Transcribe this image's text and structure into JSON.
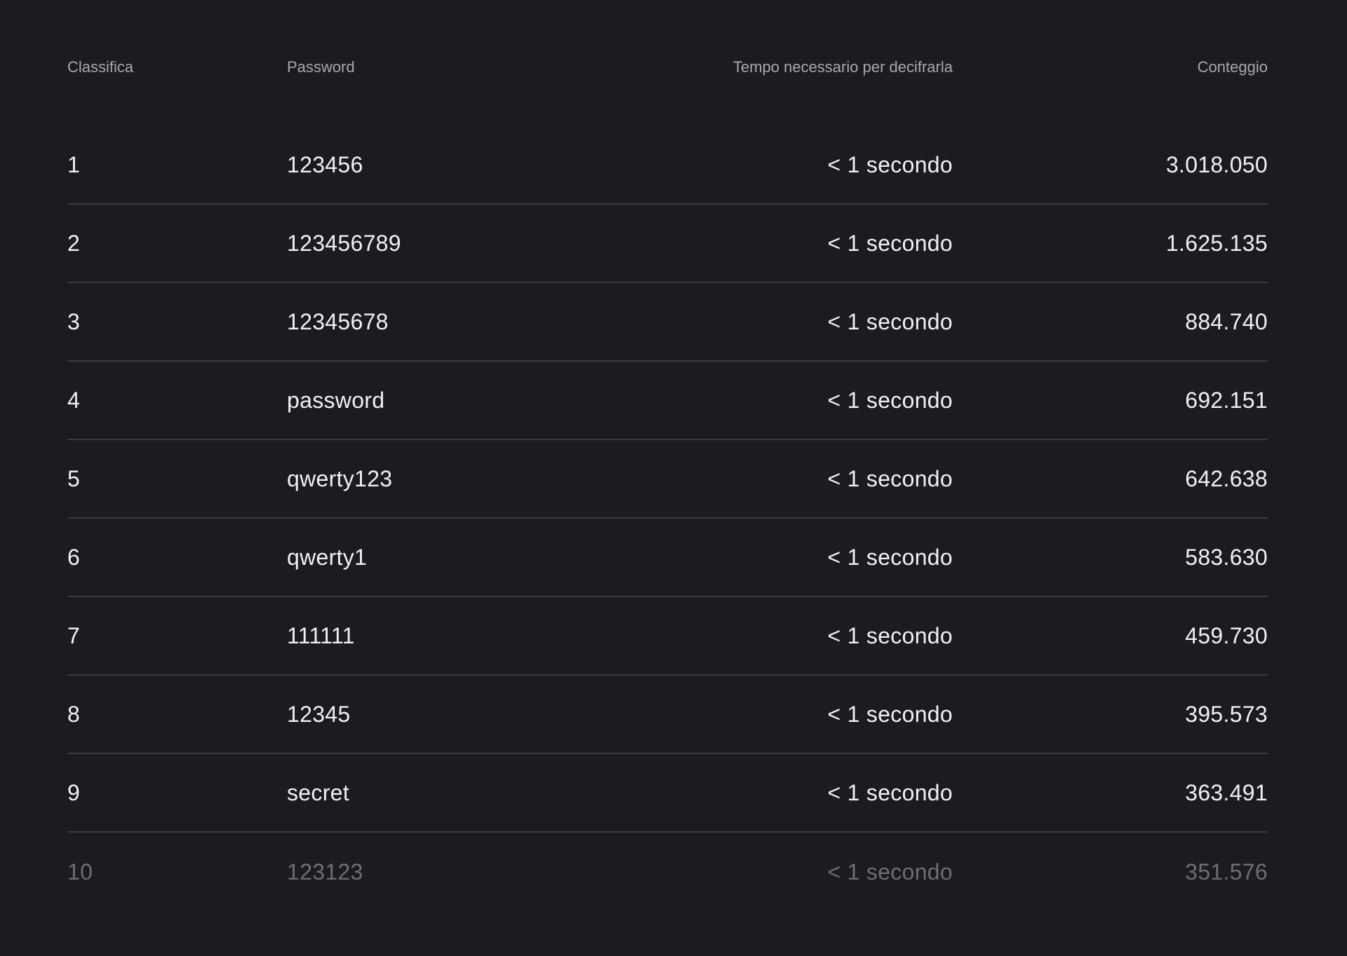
{
  "table": {
    "headers": {
      "rank": "Classifica",
      "password": "Password",
      "time": "Tempo necessario per decifrarla",
      "count": "Conteggio"
    },
    "rows": [
      {
        "rank": "1",
        "password": "123456",
        "time": "< 1 secondo",
        "count": "3.018.050"
      },
      {
        "rank": "2",
        "password": "123456789",
        "time": "< 1 secondo",
        "count": "1.625.135"
      },
      {
        "rank": "3",
        "password": "12345678",
        "time": "< 1 secondo",
        "count": "884.740"
      },
      {
        "rank": "4",
        "password": "password",
        "time": "< 1 secondo",
        "count": "692.151"
      },
      {
        "rank": "5",
        "password": "qwerty123",
        "time": "< 1 secondo",
        "count": "642.638"
      },
      {
        "rank": "6",
        "password": "qwerty1",
        "time": "< 1 secondo",
        "count": "583.630"
      },
      {
        "rank": "7",
        "password": "111111",
        "time": "< 1 secondo",
        "count": "459.730"
      },
      {
        "rank": "8",
        "password": "12345",
        "time": "< 1 secondo",
        "count": "395.573"
      },
      {
        "rank": "9",
        "password": "secret",
        "time": "< 1 secondo",
        "count": "363.491"
      },
      {
        "rank": "10",
        "password": "123123",
        "time": "< 1 secondo",
        "count": "351.576"
      }
    ]
  }
}
